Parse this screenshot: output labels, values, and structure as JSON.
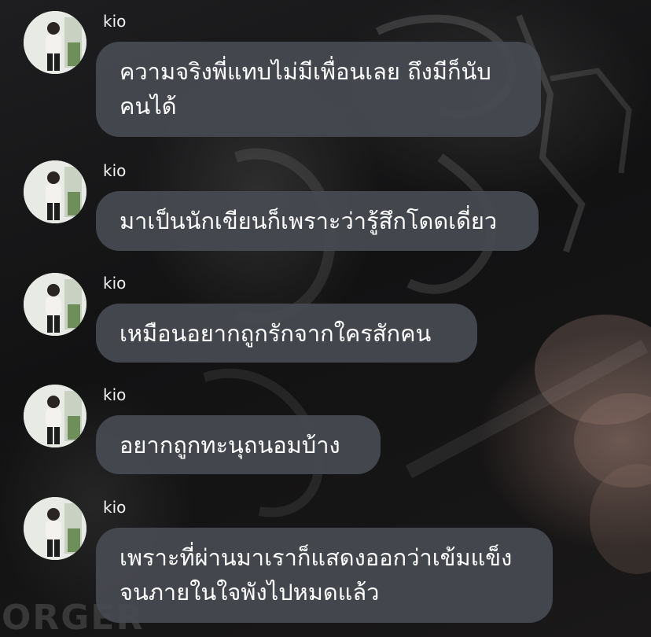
{
  "messages": [
    {
      "username": "kio",
      "lines": [
        "ความจริงพี่แทบไม่มีเพื่อนเลย ถึงมีก็นับ",
        "คนได้"
      ]
    },
    {
      "username": "kio",
      "lines": [
        "มาเป็นนักเขียนก็เพราะว่ารู้สึกโดดเดี่ยว"
      ]
    },
    {
      "username": "kio",
      "lines": [
        "เหมือนอยากถูกรักจากใครสักคน"
      ]
    },
    {
      "username": "kio",
      "lines": [
        "อยากถูกทะนุถนอมบ้าง"
      ]
    },
    {
      "username": "kio",
      "lines": [
        "เพราะที่ผ่านมาเราก็แสดงออกว่าเข้มแข็ง",
        "จนภายในใจพังไปหมดแล้ว"
      ]
    }
  ],
  "background": {
    "watermark_text": "ORGER"
  },
  "colors": {
    "bubble": "#484a52",
    "text": "#ffffff",
    "username": "#f2f2f2"
  }
}
